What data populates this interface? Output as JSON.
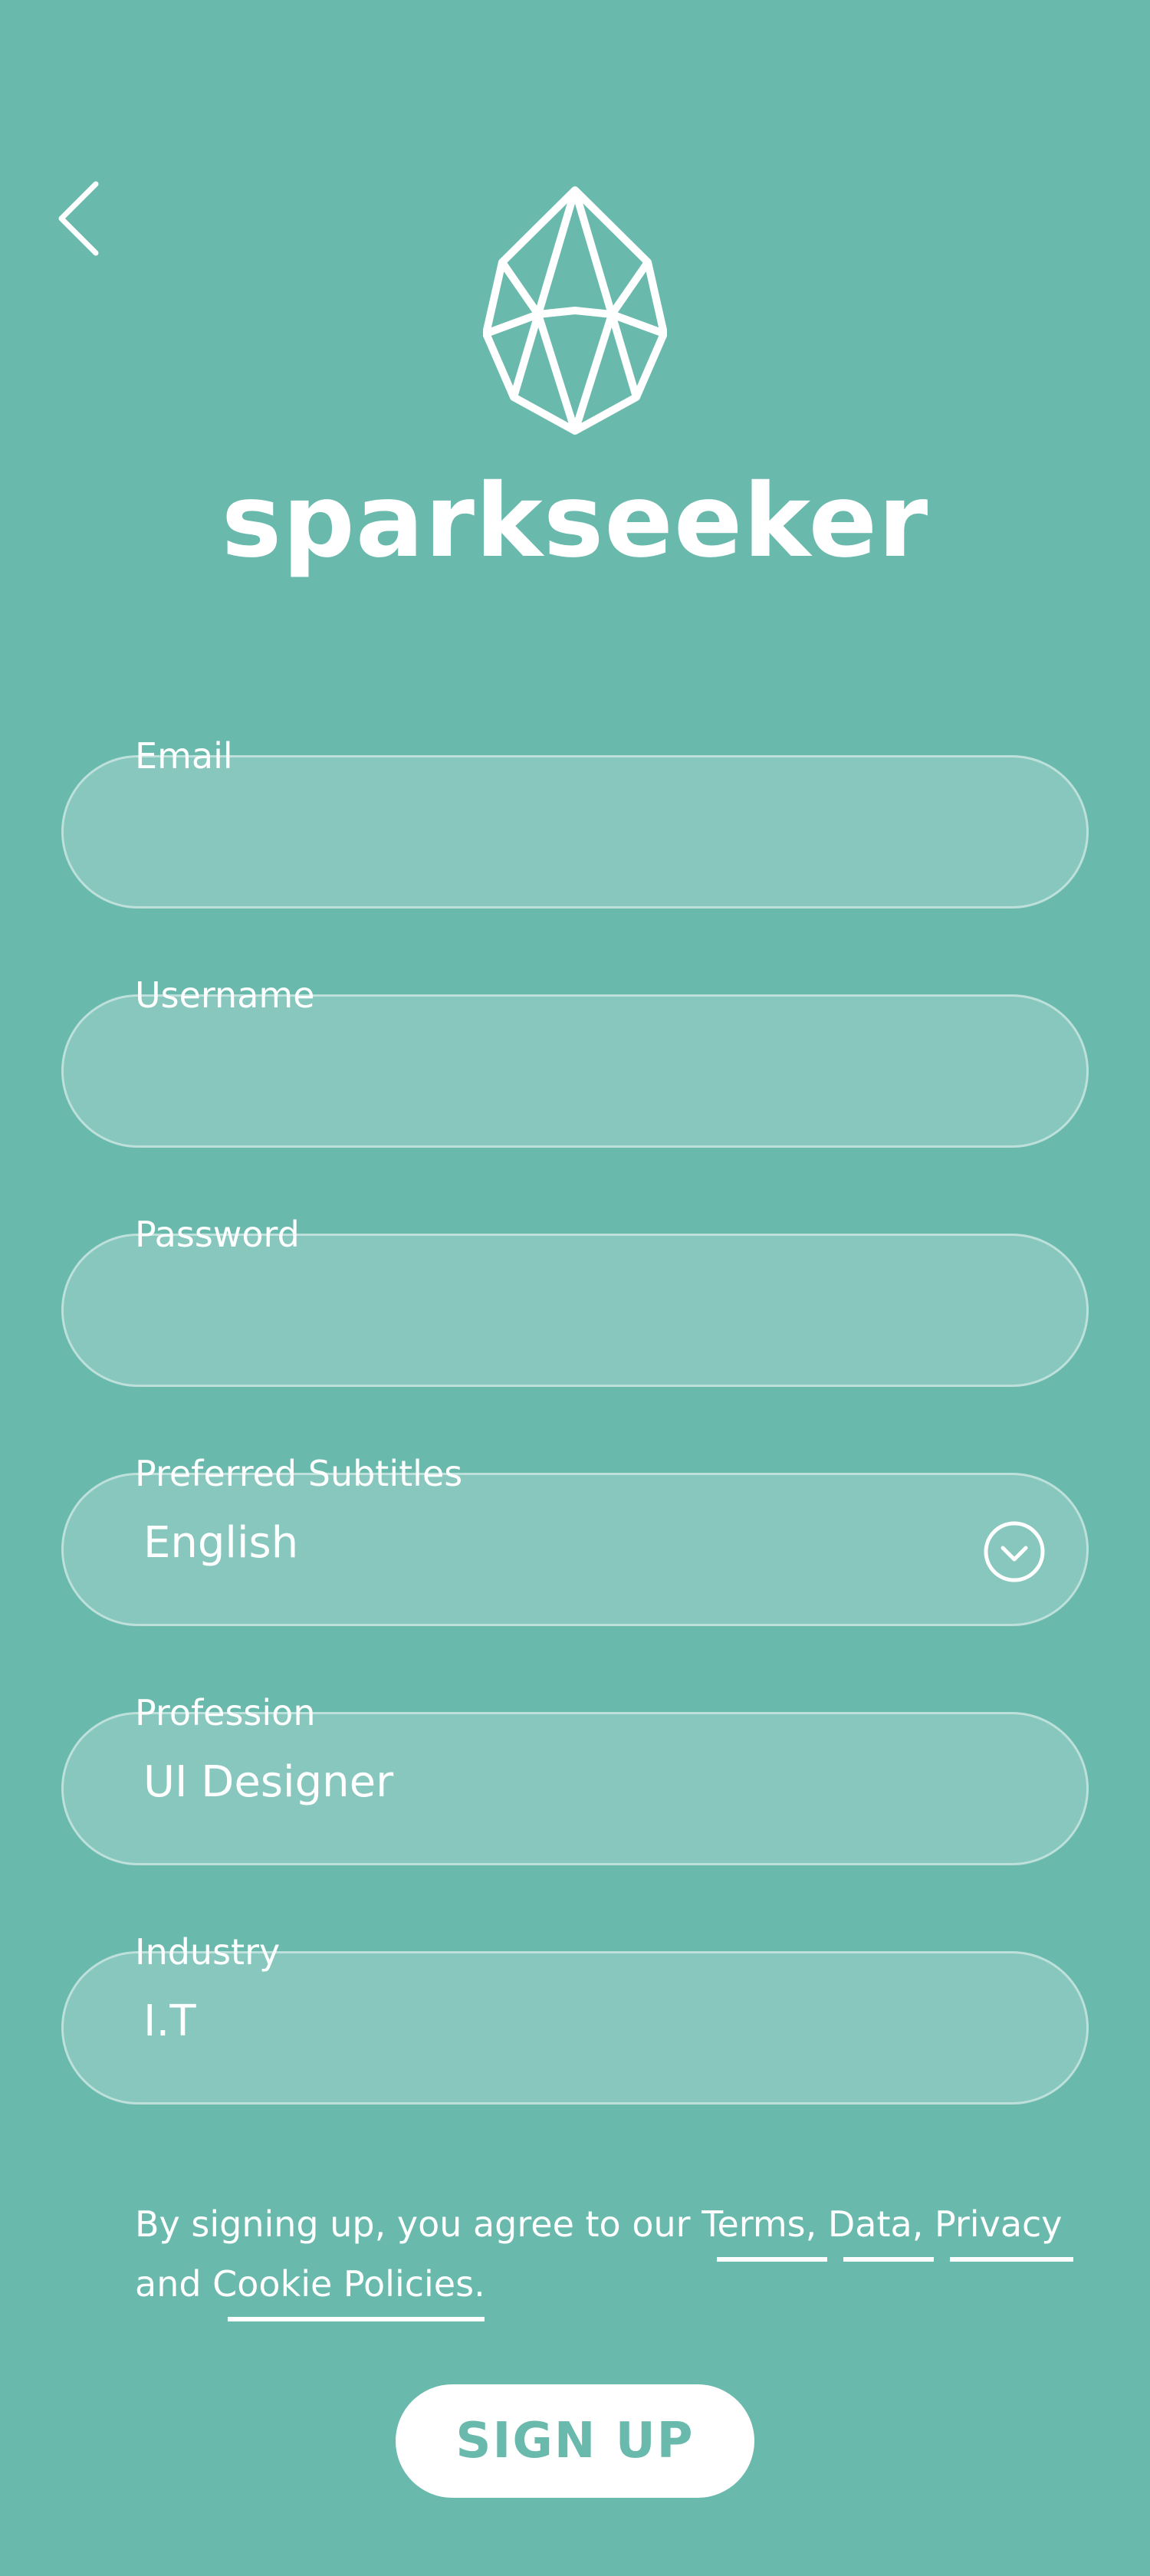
{
  "app": {
    "brand_name": "sparkseeker",
    "accent_color": "#69b9ad"
  },
  "icons": {
    "back": "chevron-left-icon",
    "logo": "crystal-drop-logo",
    "dropdown": "chevron-down-circle-icon"
  },
  "form": {
    "email": {
      "label": "Email",
      "value": ""
    },
    "username": {
      "label": "Username",
      "value": ""
    },
    "password": {
      "label": "Password",
      "value": ""
    },
    "subtitles": {
      "label": "Preferred Subtitles",
      "value": "English"
    },
    "profession": {
      "label": "Profession",
      "value": "UI Designer"
    },
    "industry": {
      "label": "Industry",
      "value": "I.T"
    }
  },
  "legal": {
    "prefix": "By signing up, you agree to our ",
    "terms": "Terms,",
    "data": "Data,",
    "privacy": "Privacy",
    "and": "and ",
    "cookie": "Cookie Policies",
    "period": "."
  },
  "actions": {
    "signup_label": "SIGN UP"
  }
}
